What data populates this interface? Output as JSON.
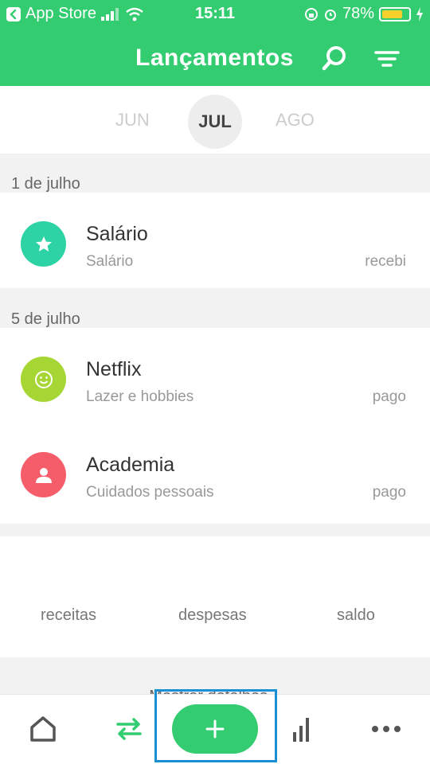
{
  "status_bar": {
    "back_app": "App Store",
    "time": "15:11",
    "battery": "78%",
    "battery_level": 0.78
  },
  "header": {
    "title": "Lançamentos",
    "search_icon": "search-icon",
    "filter_icon": "filter-icon"
  },
  "months": {
    "prev": "JUN",
    "current": "JUL",
    "next": "AGO"
  },
  "sections": [
    {
      "date": "1 de julho",
      "items": [
        {
          "title": "Salário",
          "category": "Salário",
          "status": "recebi",
          "icon": "star-icon",
          "color": "#2dd3a5"
        }
      ]
    },
    {
      "date": "5 de julho",
      "items": [
        {
          "title": "Netflix",
          "category": "Lazer e hobbies",
          "status": "pago",
          "icon": "smiley-icon",
          "color": "#a6d633"
        },
        {
          "title": "Academia",
          "category": "Cuidados pessoais",
          "status": "pago",
          "icon": "person-icon",
          "color": "#f55d6b"
        }
      ]
    }
  ],
  "summary": {
    "income_label": "receitas",
    "expenses_label": "despesas",
    "balance_label": "saldo"
  },
  "peek_text": "Mostrar detalhes...",
  "bottom_nav": {
    "home": "home-icon",
    "transactions": "transfer-icon",
    "add": "plus-icon",
    "reports": "bar-chart-icon",
    "more": "more-icon"
  },
  "colors": {
    "brand": "#33cc70",
    "highlight": "#1a8fd6"
  }
}
